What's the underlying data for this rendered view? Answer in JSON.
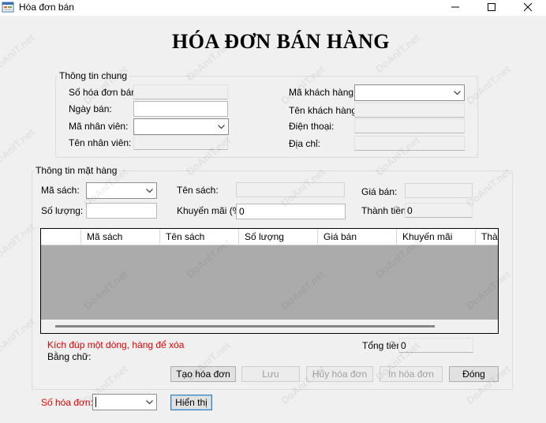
{
  "window": {
    "title": "Hóa đơn bán"
  },
  "heading": "HÓA ĐƠN BÁN HÀNG",
  "general_info": {
    "legend": "Thông tin chung",
    "invoice_no_label": "Số hóa đơn bán:",
    "sale_date_label": "Ngày bán:",
    "employee_id_label": "Mã nhân viên:",
    "employee_name_label": "Tên nhân viên:",
    "customer_id_label": "Mã khách hàng:",
    "customer_name_label": "Tên khách hàng:",
    "phone_label": "Điện thoại:",
    "address_label": "Địa chỉ:"
  },
  "item_info": {
    "legend": "Thông tin mặt hàng",
    "book_id_label": "Mã sách:",
    "book_name_label": "Tên sách:",
    "price_label": "Giá bán:",
    "quantity_label": "Số lượng:",
    "discount_label": "Khuyến mãi (%):",
    "discount_value": "0",
    "subtotal_label": "Thành tiền:",
    "subtotal_value": "0"
  },
  "grid": {
    "columns": [
      "Mã sách",
      "Tên sách",
      "Số lượng",
      "Giá bán",
      "Khuyến mãi",
      "Thành tiền"
    ]
  },
  "hint_text": "Kích đúp một dòng, hàng để xóa",
  "in_words_label": "Bằng chữ:",
  "total_label": "Tổng tiền",
  "total_value": "0",
  "buttons": {
    "create": "Tạo hóa đơn",
    "save": "Lưu",
    "cancel": "Hủy hóa đơn",
    "print": "In hóa đơn",
    "close": "Đóng",
    "show": "Hiển thị"
  },
  "search": {
    "invoice_label": "Số hóa đơn:"
  },
  "watermark": "DoAnIT.net",
  "colors": {
    "hint_red": "#e00000",
    "grid_bg": "#ababab",
    "default_button_border": "#3c7fb1"
  }
}
